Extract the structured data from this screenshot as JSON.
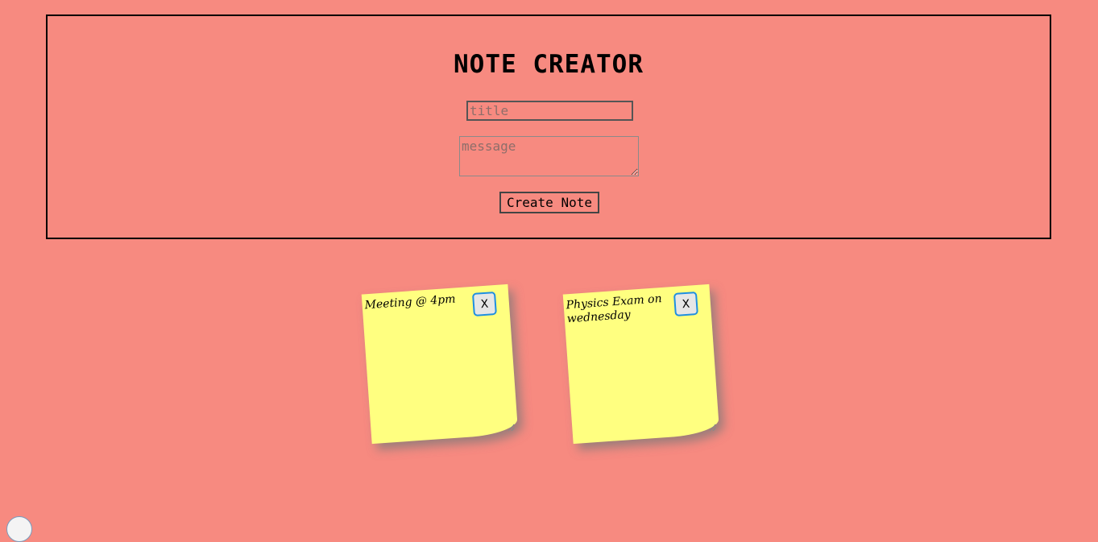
{
  "app": {
    "heading": "NOTE CREATOR"
  },
  "form": {
    "title_placeholder": "title",
    "title_value": "",
    "message_placeholder": "message",
    "message_value": "",
    "create_label": "Create Note"
  },
  "notes": [
    {
      "text": "Meeting @ 4pm",
      "close_label": "X"
    },
    {
      "text": "Physics Exam on wednesday",
      "close_label": "X"
    }
  ],
  "colors": {
    "background": "#f78a80",
    "note": "#ffff80",
    "close_border": "#1f8fe0"
  }
}
